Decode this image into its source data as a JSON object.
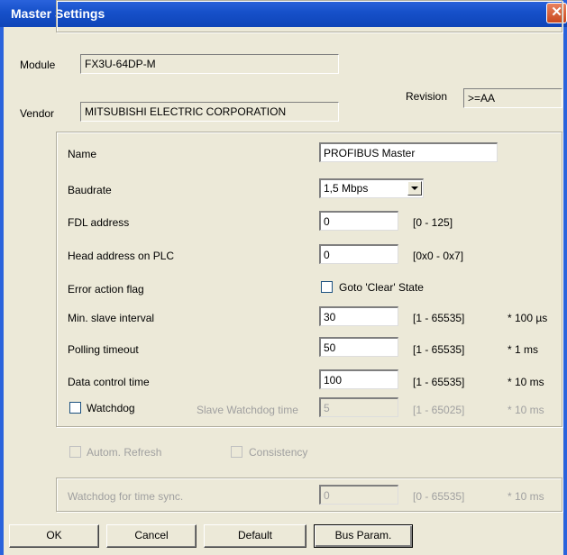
{
  "window": {
    "title": "Master Settings",
    "close_glyph": "✕"
  },
  "module": {
    "label": "Module",
    "value": "FX3U-64DP-M"
  },
  "vendor": {
    "label": "Vendor",
    "value": "MITSUBISHI ELECTRIC CORPORATION"
  },
  "revision": {
    "label": "Revision",
    "value": ">=AA"
  },
  "params": {
    "name": {
      "label": "Name",
      "value": "PROFIBUS Master"
    },
    "baudrate": {
      "label": "Baudrate",
      "value": "1,5 Mbps"
    },
    "fdl": {
      "label": "FDL address",
      "value": "0",
      "range": "[0 - 125]"
    },
    "head": {
      "label": "Head address on PLC",
      "value": "0",
      "range": "[0x0 - 0x7]"
    },
    "error_flag": {
      "label": "Error action flag",
      "checkbox_label": "Goto 'Clear' State",
      "checked": false
    },
    "min_slave": {
      "label": "Min. slave interval",
      "value": "30",
      "range": "[1 - 65535]",
      "unit": "* 100 µs"
    },
    "polling": {
      "label": "Polling timeout",
      "value": "50",
      "range": "[1 - 65535]",
      "unit": "* 1 ms"
    },
    "data_control": {
      "label": "Data control time",
      "value": "100",
      "range": "[1 - 65535]",
      "unit": "* 10 ms"
    },
    "watchdog": {
      "label": "Watchdog",
      "checked": false,
      "slave_label": "Slave Watchdog time",
      "value": "5",
      "range": "[1 - 65025]",
      "unit": "* 10 ms"
    }
  },
  "refresh": {
    "autom_label": "Autom. Refresh",
    "consistency_label": "Consistency"
  },
  "time_sync": {
    "label": "Watchdog for time sync.",
    "value": "0",
    "range": "[0 - 65535]",
    "unit": "* 10 ms"
  },
  "buttons": {
    "ok": "OK",
    "cancel": "Cancel",
    "default": "Default",
    "bus_param": "Bus Param."
  },
  "colors": {
    "titlebar": "#1650c9",
    "dialog_bg": "#ece9d8",
    "close": "#c9481e"
  }
}
